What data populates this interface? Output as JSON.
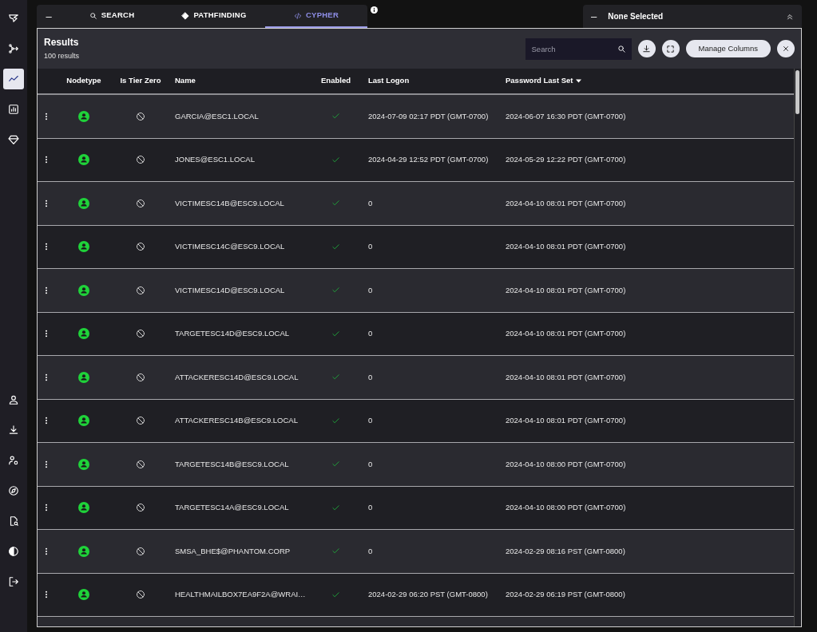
{
  "sidebar": {
    "top_items": [
      {
        "selected": false
      },
      {
        "selected": false
      },
      {
        "selected": true
      },
      {
        "selected": false
      },
      {
        "selected": false
      }
    ],
    "bottom_items": [
      {
        "selected": false
      },
      {
        "selected": false
      },
      {
        "selected": false
      },
      {
        "selected": false
      },
      {
        "selected": false
      },
      {
        "selected": false
      },
      {
        "selected": false
      }
    ]
  },
  "explore_tabs": {
    "collapse": "–",
    "tabs": [
      {
        "label": "SEARCH",
        "selected": false
      },
      {
        "label": "PATHFINDING",
        "selected": false
      },
      {
        "label": "CYPHER",
        "selected": true
      }
    ]
  },
  "selection_panel": {
    "collapse": "–",
    "title": "None Selected"
  },
  "results": {
    "title": "Results",
    "subtitle": "100 results",
    "search": {
      "placeholder": "Search"
    },
    "manage_columns": "Manage Columns",
    "columns": [
      {
        "label": "Nodetype",
        "sorted": false
      },
      {
        "label": "Is Tier Zero",
        "sorted": false
      },
      {
        "label": "Name",
        "sorted": false
      },
      {
        "label": "Enabled",
        "sorted": false
      },
      {
        "label": "Last Logon",
        "sorted": false
      },
      {
        "label": "Password Last Set",
        "sorted": true
      }
    ],
    "rows": [
      {
        "kind": "user",
        "tier_zero": false,
        "name": "GARCIA@ESC1.LOCAL",
        "enabled": true,
        "last_logon": "2024-07-09 02:17 PDT (GMT-0700)",
        "password_last_set": "2024-06-07 16:30 PDT (GMT-0700)"
      },
      {
        "kind": "user",
        "tier_zero": false,
        "name": "JONES@ESC1.LOCAL",
        "enabled": true,
        "last_logon": "2024-04-29 12:52 PDT (GMT-0700)",
        "password_last_set": "2024-05-29 12:22 PDT (GMT-0700)"
      },
      {
        "kind": "user",
        "tier_zero": false,
        "name": "VICTIMESC14B@ESC9.LOCAL",
        "enabled": true,
        "last_logon": "0",
        "password_last_set": "2024-04-10 08:01 PDT (GMT-0700)"
      },
      {
        "kind": "user",
        "tier_zero": false,
        "name": "VICTIMESC14C@ESC9.LOCAL",
        "enabled": true,
        "last_logon": "0",
        "password_last_set": "2024-04-10 08:01 PDT (GMT-0700)"
      },
      {
        "kind": "user",
        "tier_zero": false,
        "name": "VICTIMESC14D@ESC9.LOCAL",
        "enabled": true,
        "last_logon": "0",
        "password_last_set": "2024-04-10 08:01 PDT (GMT-0700)"
      },
      {
        "kind": "user",
        "tier_zero": false,
        "name": "TARGETESC14D@ESC9.LOCAL",
        "enabled": true,
        "last_logon": "0",
        "password_last_set": "2024-04-10 08:01 PDT (GMT-0700)"
      },
      {
        "kind": "user",
        "tier_zero": false,
        "name": "ATTACKERESC14D@ESC9.LOCAL",
        "enabled": true,
        "last_logon": "0",
        "password_last_set": "2024-04-10 08:01 PDT (GMT-0700)"
      },
      {
        "kind": "user",
        "tier_zero": false,
        "name": "ATTACKERESC14B@ESC9.LOCAL",
        "enabled": true,
        "last_logon": "0",
        "password_last_set": "2024-04-10 08:01 PDT (GMT-0700)"
      },
      {
        "kind": "user",
        "tier_zero": false,
        "name": "TARGETESC14B@ESC9.LOCAL",
        "enabled": true,
        "last_logon": "0",
        "password_last_set": "2024-04-10 08:00 PDT (GMT-0700)"
      },
      {
        "kind": "user",
        "tier_zero": false,
        "name": "TARGETESC14A@ESC9.LOCAL",
        "enabled": true,
        "last_logon": "0",
        "password_last_set": "2024-04-10 08:00 PDT (GMT-0700)"
      },
      {
        "kind": "user",
        "tier_zero": false,
        "name": "SMSA_BHE$@PHANTOM.CORP",
        "enabled": true,
        "last_logon": "0",
        "password_last_set": "2024-02-29 08:16 PST (GMT-0800)"
      },
      {
        "kind": "user",
        "tier_zero": false,
        "name": "HEALTHMAILBOX7EA9F2A@WRAI…",
        "enabled": true,
        "last_logon": "2024-02-29 06:20 PST (GMT-0800)",
        "password_last_set": "2024-02-29 06:19 PST (GMT-0800)"
      }
    ]
  }
}
